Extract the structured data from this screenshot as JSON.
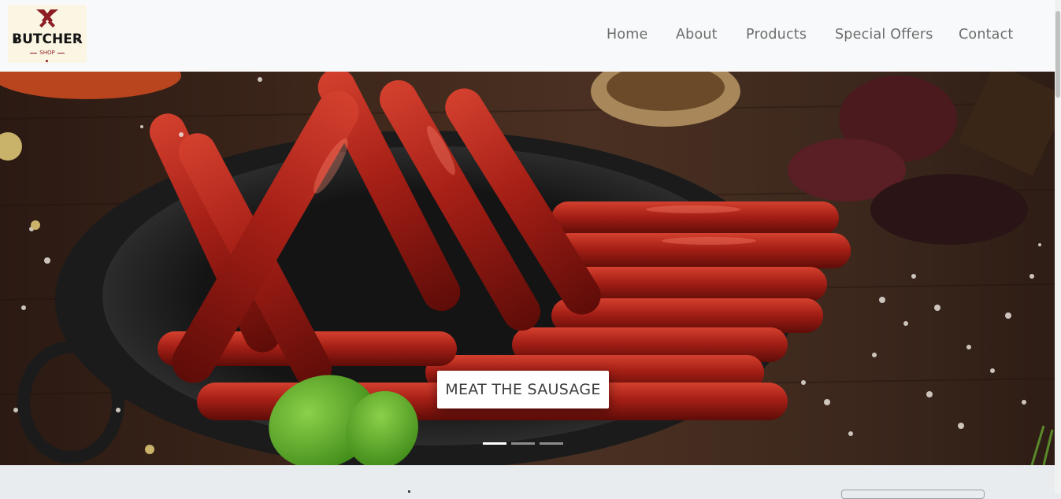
{
  "brand": {
    "logo_title": "BUTCHER",
    "logo_subtitle": "SHOP",
    "logo_icon": "crossed-cleavers-icon",
    "accent": "#8d1e25"
  },
  "nav": {
    "items": [
      {
        "label": "Home"
      },
      {
        "label": "About"
      },
      {
        "label": "Products"
      },
      {
        "label": "Special Offers"
      },
      {
        "label": "Contact"
      }
    ]
  },
  "hero": {
    "caption": "MEAT THE SAUSAGE",
    "slides": 3,
    "active_slide": 1
  },
  "colors": {
    "navbar_bg": "#f8f9fa",
    "page_bg": "#e9ecef",
    "nav_text": "#6c6c6c"
  }
}
